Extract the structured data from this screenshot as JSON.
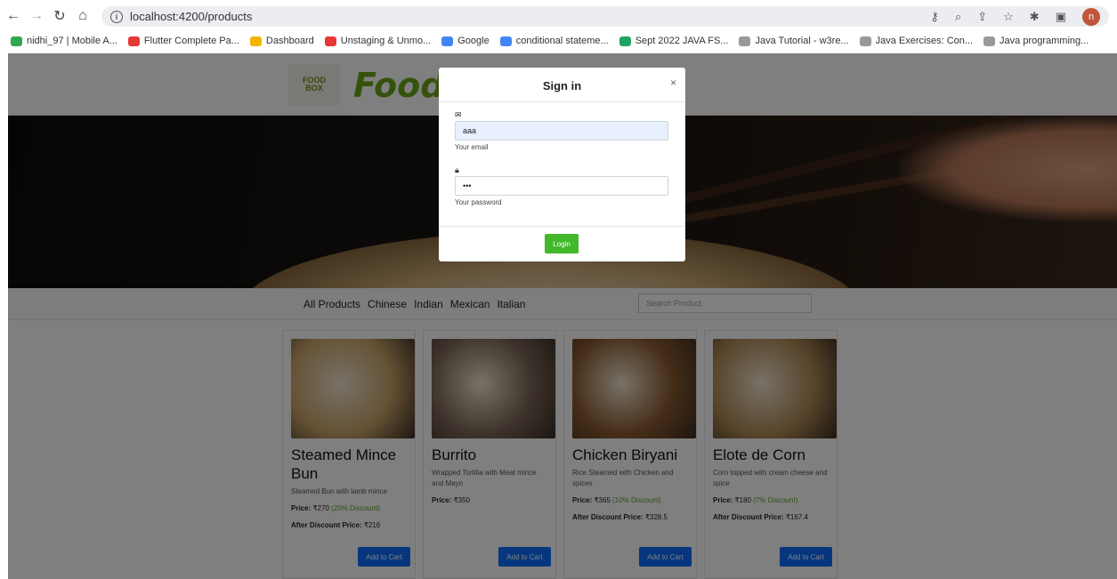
{
  "browser": {
    "url": "localhost:4200/products",
    "avatar_letter": "n",
    "bookmarks": [
      {
        "label": "nidhi_97 | Mobile A...",
        "color": "#2fa84f"
      },
      {
        "label": "Flutter Complete Pa...",
        "color": "#e53935"
      },
      {
        "label": "Dashboard",
        "color": "#f4b400"
      },
      {
        "label": "Unstaging & Unmo...",
        "color": "#e53935"
      },
      {
        "label": "Google",
        "color": "#4285f4"
      },
      {
        "label": "conditional stateme...",
        "color": "#4285f4"
      },
      {
        "label": "Sept 2022 JAVA FS...",
        "color": "#1fa463"
      },
      {
        "label": "Java Tutorial - w3re...",
        "color": "#999999"
      },
      {
        "label": "Java Exercises: Con...",
        "color": "#999999"
      },
      {
        "label": "Java programming...",
        "color": "#999999"
      }
    ]
  },
  "site": {
    "logo_text_1": "FOOD",
    "logo_text_2": "BOX",
    "brand": "FoodB"
  },
  "categories": [
    "All Products",
    "Chinese",
    "Indian",
    "Mexican",
    "Italian"
  ],
  "search": {
    "placeholder": "Search Product"
  },
  "products": [
    {
      "name": "Steamed Mince Bun",
      "desc": "Steamed Bun with lamb mince",
      "price_label": "Price:",
      "price": "₹270",
      "discount": "(20% Discount)",
      "after_label": "After Discount Price:",
      "after": "₹216",
      "button": "Add to Cart",
      "img_color": "#c9a468"
    },
    {
      "name": "Burrito",
      "desc": "Wrapped Tortilla with Meat mince and Mayo",
      "price_label": "Price:",
      "price": "₹350",
      "discount": "",
      "after_label": "",
      "after": "",
      "button": "Add to Cart",
      "img_color": "#7a6657"
    },
    {
      "name": "Chicken Biryani",
      "desc": "Rice Steamed with Chicken and spices",
      "price_label": "Price:",
      "price": "₹365",
      "discount": "(10% Discount)",
      "after_label": "After Discount Price:",
      "after": "₹328.5",
      "button": "Add to Cart",
      "img_color": "#8a5a2e"
    },
    {
      "name": "Elote de Corn",
      "desc": "Corn topped with cream cheese and spice",
      "price_label": "Price:",
      "price": "₹180",
      "discount": "(7% Discount)",
      "after_label": "After Discount Price:",
      "after": "₹167.4",
      "button": "Add to Cart",
      "img_color": "#b08a55"
    }
  ],
  "modal": {
    "title": "Sign in",
    "close": "×",
    "email_value": "aaa",
    "email_hint": "Your email",
    "password_value": "•••",
    "password_hint": "Your password",
    "login": "Login"
  }
}
